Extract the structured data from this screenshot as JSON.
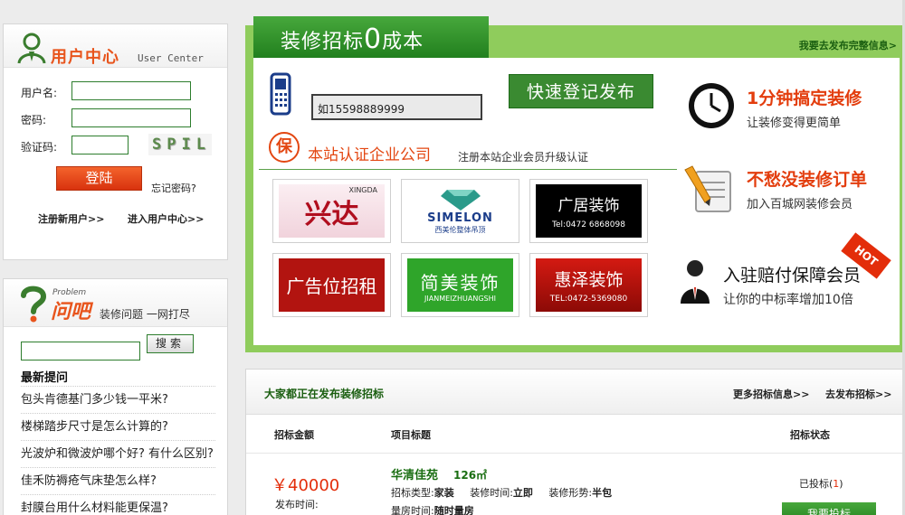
{
  "user_center": {
    "title": "用户中心",
    "subtitle": "User Center",
    "username_label": "用户名:",
    "password_label": "密码:",
    "captcha_label": "验证码:",
    "captcha_text": "SPIL",
    "login_button": "登陆",
    "forgot_link": "忘记密码?",
    "register_link": "注册新用户>>",
    "enter_center_link": "进入用户中心>>"
  },
  "qa": {
    "logo_en": "Problem",
    "logo": "问吧",
    "slogan": "装修问题 一网打尽",
    "search_button": "搜索",
    "latest_title": "最新提问",
    "questions": [
      "包头肯德基门多少钱一平米?",
      "楼梯踏步尺寸是怎么计算的?",
      "光波炉和微波炉哪个好? 有什么区别?",
      "佳禾防褥疮气床垫怎么样?",
      "封膜台用什么材料能更保温?"
    ]
  },
  "promo": {
    "tab_prefix": "装修招标",
    "tab_zero": "0",
    "tab_suffix": "成本",
    "right_link": "我要去发布完整信息>",
    "phone_value": "如15598889999",
    "quick_button": "快速登记发布",
    "cert_icon": "保",
    "cert_title": "本站认证企业公司",
    "cert_sub": "注册本站企业会员升级认证",
    "logos": [
      {
        "main": "兴达",
        "sub": "XINGDA"
      },
      {
        "main": "SIMELON",
        "sub": "西美伦整体吊顶"
      },
      {
        "main": "广居装饰",
        "sub": "Tel:0472 6868098"
      },
      {
        "main": "广告位招租",
        "sub": ""
      },
      {
        "main": "简美装饰",
        "sub": "JIANMEIZHUANGSHI"
      },
      {
        "main": "惠泽装饰",
        "sub": "TEL:0472-5369080"
      }
    ],
    "features": [
      {
        "title": "1分钟搞定装修",
        "sub": "让装修变得更简单"
      },
      {
        "title": "不愁没装修订单",
        "sub": "加入百城网装修会员"
      },
      {
        "title": "入驻赔付保障会员",
        "sub": "让你的中标率增加10倍"
      }
    ],
    "hot_badge": "HOT"
  },
  "bids": {
    "title": "大家都正在发布装修招标",
    "more_link": "更多招标信息>>",
    "post_link": "去发布招标>>",
    "col_amount": "招标金额",
    "col_title": "项目标题",
    "col_status": "招标状态",
    "rows": [
      {
        "amount": "￥40000",
        "publish_label": "发布时间:",
        "title": "华清佳苑",
        "area": "126㎡",
        "type_label": "招标类型:",
        "type_value": "家装",
        "time_label": "装修时间:",
        "time_value": "立即",
        "form_label": "装修形势:",
        "form_value": "半包",
        "measure_label": "量房时间:",
        "measure_value": "随时量房",
        "status_prefix": "已投标(",
        "status_count": "1",
        "status_suffix": ")",
        "bid_button": "我要投标"
      }
    ]
  }
}
